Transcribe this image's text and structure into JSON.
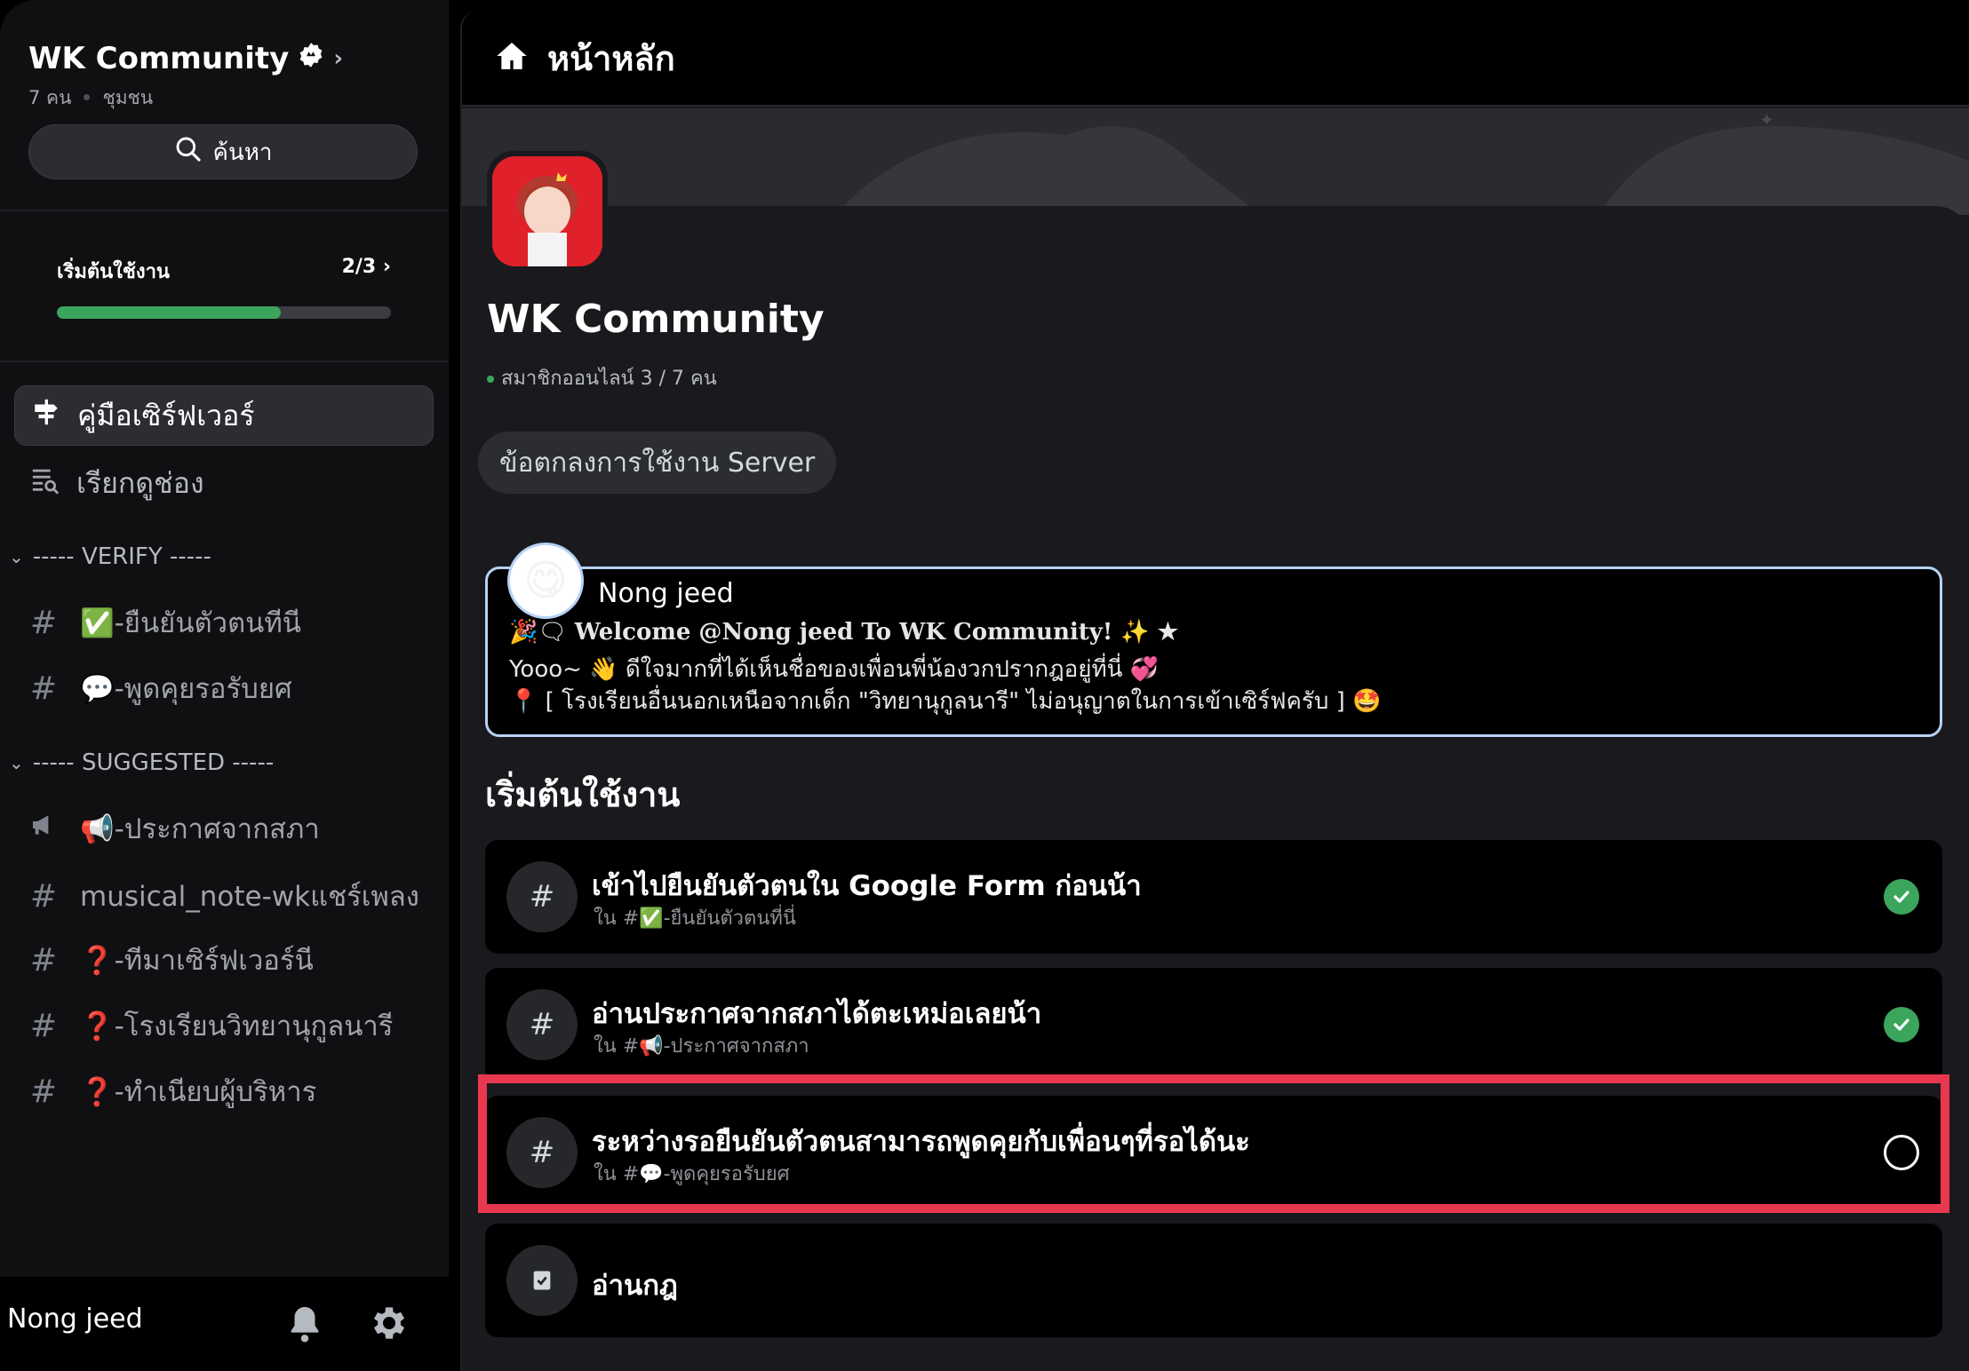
{
  "server": {
    "name": "WK Community",
    "member_count": "7 คน",
    "type": "ชุมชน",
    "search_label": "ค้นหา"
  },
  "onboarding": {
    "label": "เริ่มต้นใช้งาน",
    "progress_text": "2/3",
    "progress_fraction": 0.67
  },
  "sidebar": {
    "nav": [
      {
        "label": "คู่มือเซิร์ฟเวอร์",
        "icon": "signpost-icon"
      },
      {
        "label": "เรียกดูช่อง",
        "icon": "browse-channels-icon"
      }
    ],
    "categories": [
      {
        "label": "----- VERIFY -----",
        "channels": [
          {
            "prefix": "#",
            "emoji": "✅",
            "label": "-ยืนยันตัวตนทีนี"
          },
          {
            "prefix": "#",
            "emoji": "💬",
            "label": "-พูดคุยรอรับยศ"
          }
        ]
      },
      {
        "label": "----- SUGGESTED -----",
        "channels": [
          {
            "prefix": "📢",
            "emoji": "📢",
            "label": "-ประกาศจากสภา"
          },
          {
            "prefix": "#",
            "emoji": "",
            "label": "musical_note-wkแชร์เพลง"
          },
          {
            "prefix": "#",
            "emoji": "❓",
            "label": "-ทีมาเซิร์ฟเวอร์นี"
          },
          {
            "prefix": "#",
            "emoji": "❓",
            "label": "-โรงเรียนวิทยานุกูลนารี"
          },
          {
            "prefix": "#",
            "emoji": "❓",
            "label": "-ทำเนียบผู้บริหาร"
          }
        ]
      }
    ]
  },
  "user": {
    "name": "Nong jeed"
  },
  "main": {
    "title": "หน้าหลัก",
    "server_name": "WK Community",
    "online_text": "สมาชิกออนไลน์ 3 / 7 คน",
    "rules_button": "ข้อตกลงการใช้งาน Server",
    "welcome": {
      "author": "Nong jeed",
      "line1_emoji": "🎉🗨",
      "line1": "Welcome @Nong jeed To WK Community! ✨ ★",
      "line2": "Yooo~ 👋 ดีใจมากที่ได้เห็นชื่อของเพื่อนพี่น้องวกปรากฎอยู่ที่นี่ 💞",
      "line3": "📍 [ โรงเรียนอื่นนอกเหนือจากเด็ก \"วิทยานุกูลนารี\" ไม่อนุญาตในการเข้าเซิร์ฟครับ ] 🤩"
    },
    "section_title": "เริ่มต้นใช้งาน",
    "tasks": [
      {
        "title": "เข้าไปยืนยันตัวตนใน Google Form ก่อนน้า",
        "sub": "ใน #✅-ยืนยันตัวตนที่นี่",
        "icon": "#",
        "done": true
      },
      {
        "title": "อ่านประกาศจากสภาได้ตะเหม่อเลยน้า",
        "sub": "ใน #📢-ประกาศจากสภา",
        "icon": "#",
        "done": true
      },
      {
        "title": "ระหว่างรอยืนยันตัวตนสามารถพูดคุยกับเพื่อนๆที่รอได้นะ",
        "sub": "ใน #💬-พูดคุยรอรับยศ",
        "icon": "#",
        "done": false
      },
      {
        "title": "อ่านกฎ",
        "sub": "",
        "icon": "rules-icon",
        "done": null
      }
    ]
  },
  "colors": {
    "accent_green": "#3ba55c",
    "highlight_red": "#e8384f",
    "welcome_border": "#b6d3f5"
  }
}
